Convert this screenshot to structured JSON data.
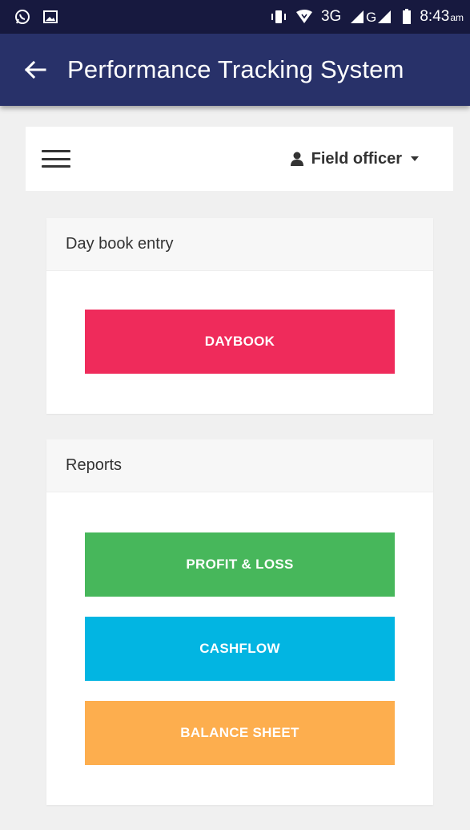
{
  "status_bar": {
    "signal_text": "3G",
    "time": "8:43",
    "ampm": "am",
    "icons": [
      "whatsapp-icon",
      "image-icon",
      "vibrate-icon",
      "wifi-icon",
      "signal-icon",
      "battery-icon"
    ]
  },
  "app_bar": {
    "title": "Performance Tracking System",
    "back_icon": "arrow-left-icon"
  },
  "header": {
    "menu_icon": "hamburger-icon",
    "user_label": "Field officer",
    "user_icon": "user-icon",
    "dropdown_icon": "caret-down-icon"
  },
  "panels": [
    {
      "title": "Day book entry",
      "buttons": [
        {
          "label": "DAYBOOK",
          "color": "#ef2b5b"
        }
      ]
    },
    {
      "title": "Reports",
      "buttons": [
        {
          "label": "PROFIT & LOSS",
          "color": "#47b75b"
        },
        {
          "label": "CASHFLOW",
          "color": "#02b5e2"
        },
        {
          "label": "BALANCE SHEET",
          "color": "#fdae4e"
        }
      ]
    }
  ],
  "colors": {
    "status_bar": "#17193f",
    "app_bar": "#283169",
    "background": "#f0f0f0"
  }
}
